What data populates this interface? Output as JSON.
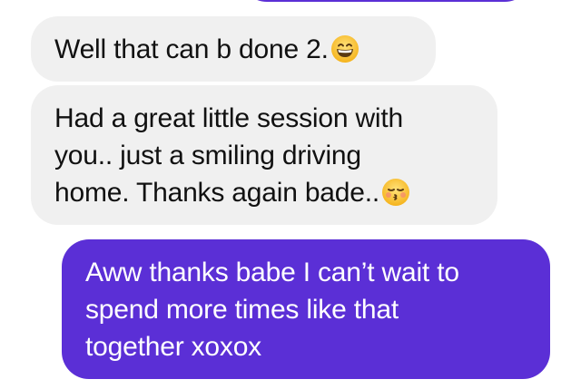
{
  "messages": [
    {
      "direction": "incoming",
      "text": "Well that can b done 2.",
      "emoji": "grinning-face-icon"
    },
    {
      "direction": "incoming",
      "lines": [
        "Had a great little  session with",
        "you.. just a smiling driving",
        "home. Thanks again bade.."
      ],
      "emoji": "kissing-face-icon"
    },
    {
      "direction": "outgoing",
      "lines": [
        "Aww thanks babe I can’t wait to",
        "spend more times like that",
        "together xoxox"
      ]
    }
  ],
  "colors": {
    "incoming_bubble": "#f0f0f0",
    "outgoing_bubble": "#5b2fd6",
    "incoming_text": "#111111",
    "outgoing_text": "#ffffff"
  }
}
